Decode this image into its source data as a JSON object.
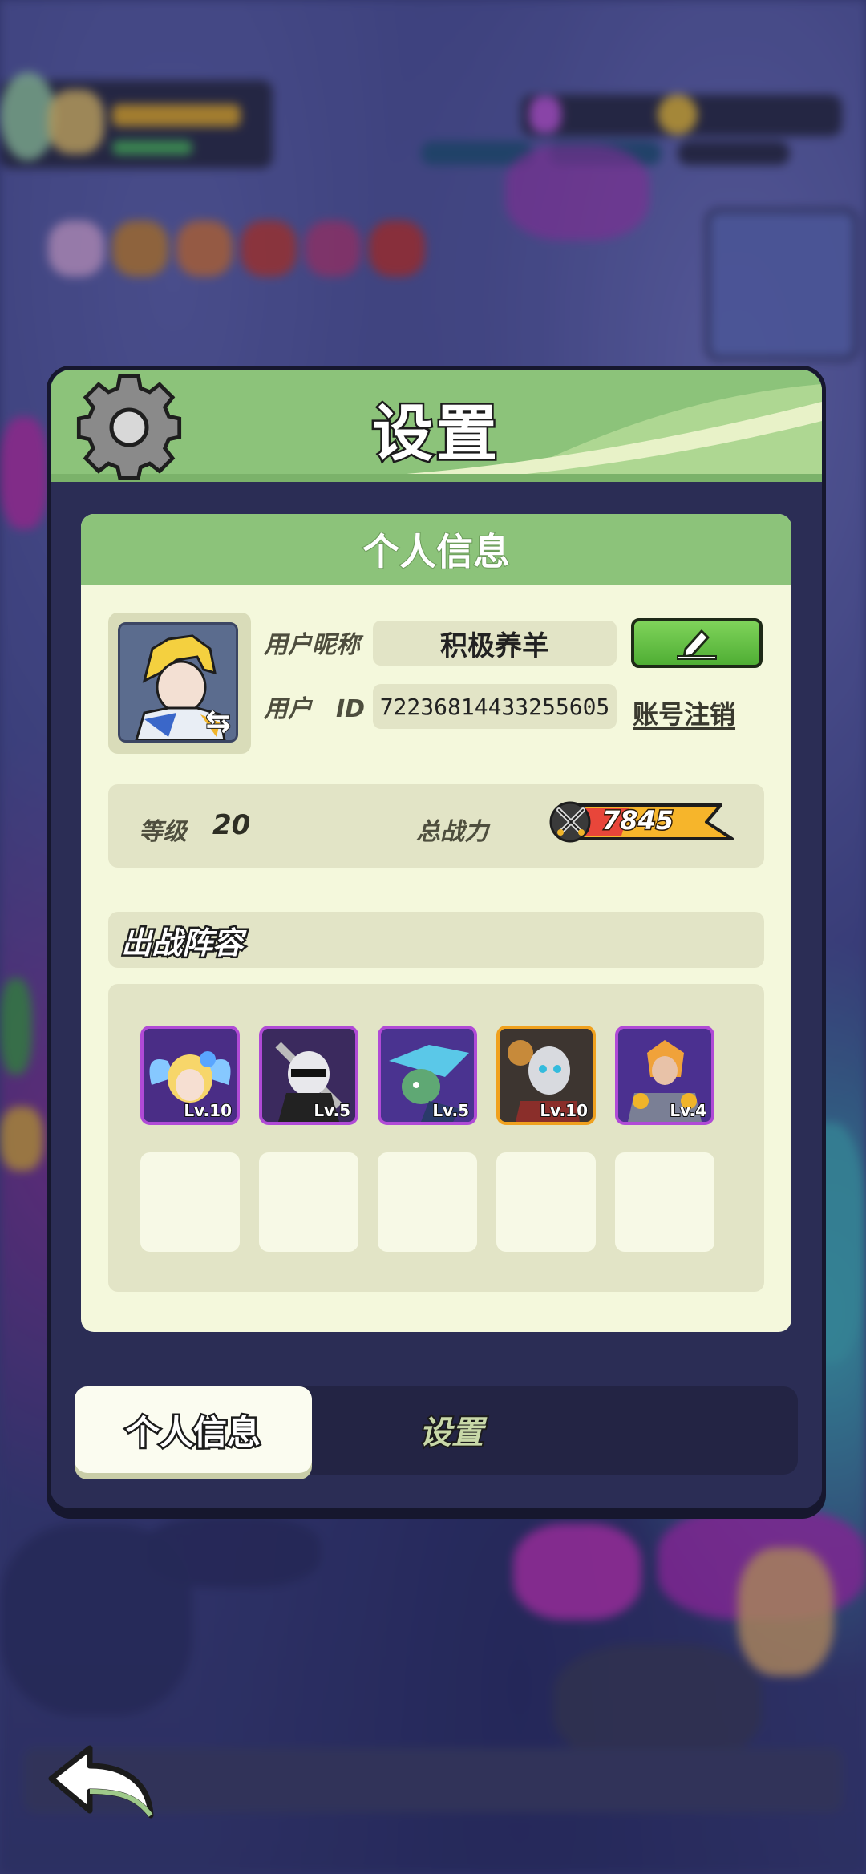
{
  "dialog": {
    "title": "设置"
  },
  "profile": {
    "panel_title": "个人信息",
    "nickname_label": "用户昵称",
    "nickname_value": "积极养羊",
    "id_label": "用户　ID",
    "id_value": "72236814433255605",
    "cancel_account": "账号注销",
    "level_label": "等级",
    "level_value": "20",
    "power_label": "总战力",
    "power_value": "7845"
  },
  "lineup": {
    "title": "出战阵容",
    "heroes": [
      {
        "level": "Lv.10",
        "rarity": "purple"
      },
      {
        "level": "Lv.5",
        "rarity": "purple"
      },
      {
        "level": "Lv.5",
        "rarity": "purple"
      },
      {
        "level": "Lv.10",
        "rarity": "gold"
      },
      {
        "level": "Lv.4",
        "rarity": "purple"
      }
    ]
  },
  "tabs": {
    "personal": "个人信息",
    "settings": "设置"
  },
  "icons": {
    "gear": "gear-icon",
    "edit": "pencil-icon",
    "swap": "swap-icon",
    "power": "crossed-swords-icon",
    "back": "back-arrow-icon"
  },
  "colors": {
    "header_green": "#8cc37a",
    "panel_bg": "#f4f8dc",
    "edit_green": "#5cbd3c",
    "purple_rarity": "#b04ad6",
    "gold_rarity": "#f0a11e"
  }
}
